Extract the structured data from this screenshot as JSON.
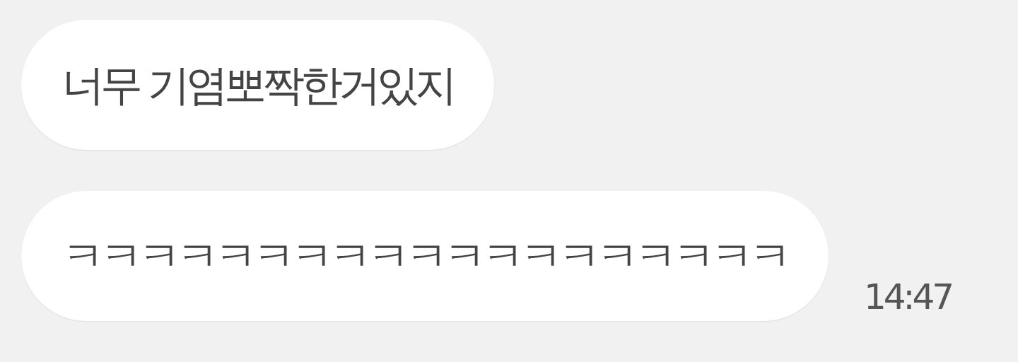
{
  "messages": [
    {
      "text": "너무 기염뽀짝한거있지"
    },
    {
      "text": "ㅋㅋㅋㅋㅋㅋㅋㅋㅋㅋㅋㅋㅋㅋㅋㅋㅋㅋㅋ",
      "time": "14:47"
    }
  ]
}
